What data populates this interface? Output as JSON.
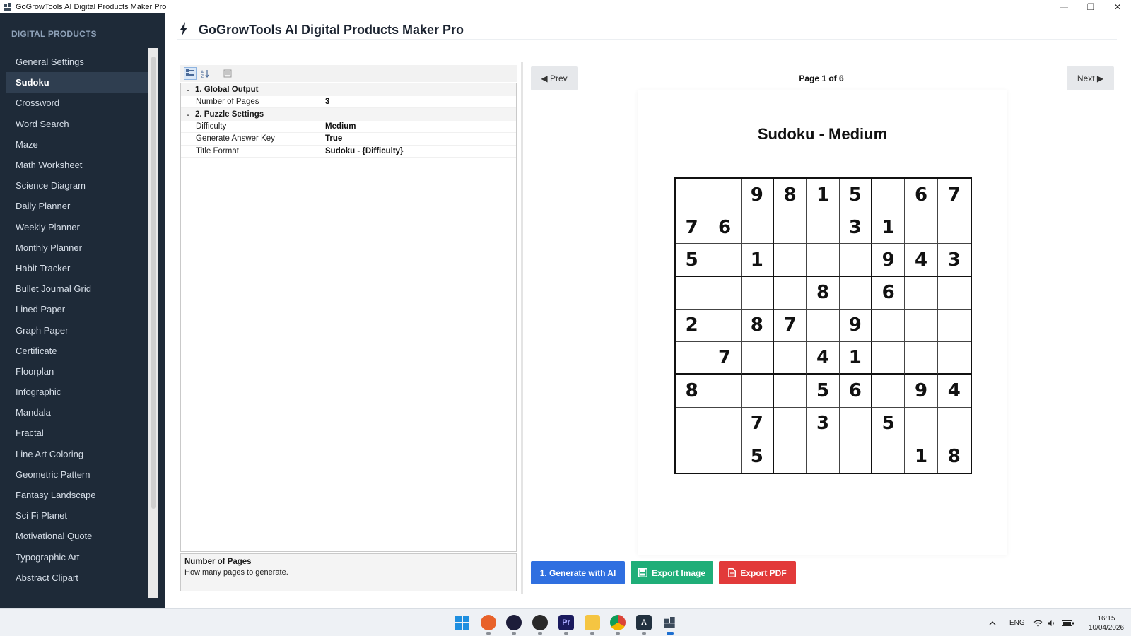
{
  "window": {
    "title": "GoGrowTools AI Digital Products Maker Pro",
    "controls": {
      "minimize": "—",
      "restore": "❐",
      "close": "✕"
    }
  },
  "sidebar": {
    "heading": "DIGITAL PRODUCTS",
    "items": [
      {
        "label": "General Settings"
      },
      {
        "label": "Sudoku"
      },
      {
        "label": "Crossword"
      },
      {
        "label": "Word Search"
      },
      {
        "label": "Maze"
      },
      {
        "label": "Math Worksheet"
      },
      {
        "label": "Science Diagram"
      },
      {
        "label": "Daily Planner"
      },
      {
        "label": "Weekly Planner"
      },
      {
        "label": "Monthly Planner"
      },
      {
        "label": "Habit Tracker"
      },
      {
        "label": "Bullet Journal Grid"
      },
      {
        "label": "Lined Paper"
      },
      {
        "label": "Graph Paper"
      },
      {
        "label": "Certificate"
      },
      {
        "label": "Floorplan"
      },
      {
        "label": "Infographic"
      },
      {
        "label": "Mandala"
      },
      {
        "label": "Fractal"
      },
      {
        "label": "Line Art Coloring"
      },
      {
        "label": "Geometric Pattern"
      },
      {
        "label": "Fantasy Landscape"
      },
      {
        "label": "Sci Fi Planet"
      },
      {
        "label": "Motivational Quote"
      },
      {
        "label": "Typographic Art"
      },
      {
        "label": "Abstract Clipart"
      }
    ],
    "active_item": "Sudoku"
  },
  "header": {
    "title": "GoGrowTools AI Digital Products Maker Pro",
    "icon": "lightning-bolt-icon"
  },
  "properties": {
    "categories": [
      {
        "name": "1. Global Output",
        "rows": [
          {
            "key": "Number of Pages",
            "value": "3"
          }
        ]
      },
      {
        "name": "2. Puzzle Settings",
        "rows": [
          {
            "key": "Difficulty",
            "value": "Medium"
          },
          {
            "key": "Generate Answer Key",
            "value": "True"
          },
          {
            "key": "Title Format",
            "value": "Sudoku - {Difficulty}"
          }
        ]
      }
    ],
    "description": {
      "title": "Number of Pages",
      "text": "How many pages to generate."
    }
  },
  "preview": {
    "prev_label": "◀ Prev",
    "next_label": "Next ▶",
    "page_indicator": "Page 1 of 6",
    "puzzle_title": "Sudoku - Medium",
    "grid": [
      [
        "",
        "",
        "9",
        "8",
        "1",
        "5",
        "",
        "6",
        "7"
      ],
      [
        "7",
        "6",
        "",
        "",
        "",
        "3",
        "1",
        "",
        ""
      ],
      [
        "5",
        "",
        "1",
        "",
        "",
        "",
        "9",
        "4",
        "3"
      ],
      [
        "",
        "",
        "",
        "",
        "8",
        "",
        "6",
        "",
        ""
      ],
      [
        "2",
        "",
        "8",
        "7",
        "",
        "9",
        "",
        "",
        ""
      ],
      [
        "",
        "7",
        "",
        "",
        "4",
        "1",
        "",
        "",
        ""
      ],
      [
        "8",
        "",
        "",
        "",
        "5",
        "6",
        "",
        "9",
        "4"
      ],
      [
        "",
        "",
        "7",
        "",
        "3",
        "",
        "5",
        "",
        ""
      ],
      [
        "",
        "",
        "5",
        "",
        "",
        "",
        "",
        "1",
        "8"
      ]
    ]
  },
  "actions": {
    "generate": "1. Generate with AI",
    "export_image": "Export Image",
    "export_pdf": "Export PDF"
  },
  "colors": {
    "sidebar_bg": "#1e2a38",
    "generate_btn": "#2f6fe0",
    "export_image_btn": "#1fae78",
    "export_pdf_btn": "#e23a3a"
  },
  "taskbar": {
    "apps": [
      "windows-start-icon",
      "firefox-icon",
      "app-circle-icon",
      "obs-icon",
      "premiere-pro-icon",
      "file-explorer-icon",
      "chrome-icon",
      "app-a-icon",
      "gogrowtools-app-icon"
    ],
    "tray": {
      "language": "ENG",
      "time": "16:15",
      "date": "10/04/2026"
    }
  }
}
